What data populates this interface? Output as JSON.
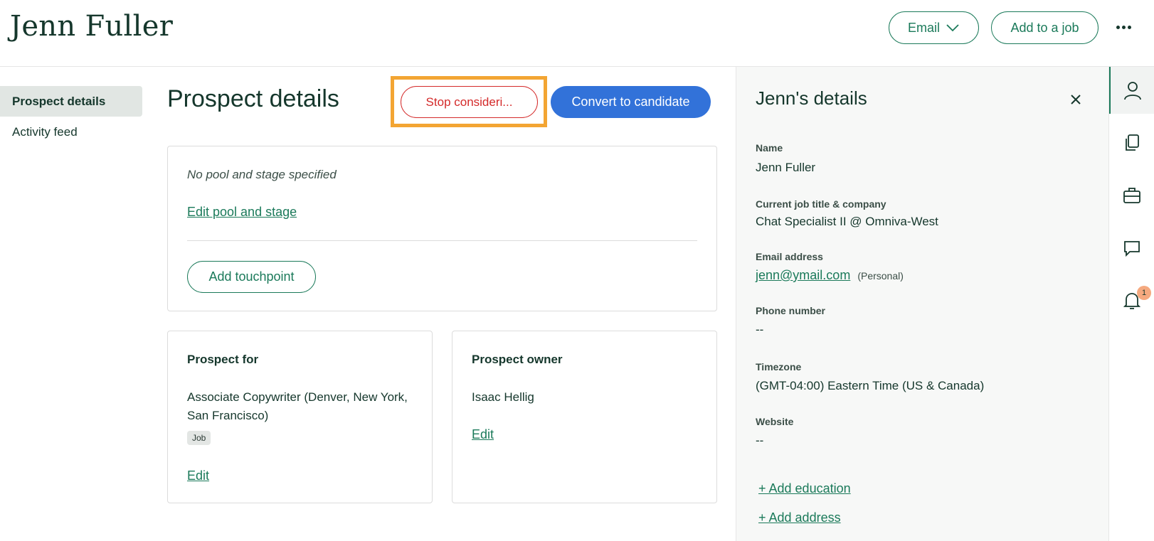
{
  "header": {
    "person_name": "Jenn Fuller",
    "email_label": "Email",
    "add_to_job_label": "Add to a job",
    "more_icon": "more-horizontal-icon"
  },
  "nav": {
    "items": [
      {
        "label": "Prospect details",
        "active": true
      },
      {
        "label": "Activity feed",
        "active": false
      }
    ]
  },
  "main": {
    "title": "Prospect details",
    "stop_label": "Stop consideri...",
    "convert_label": "Convert to candidate",
    "pool": {
      "text": "No pool and stage specified",
      "edit_label": "Edit pool and stage",
      "touchpoint_label": "Add touchpoint"
    },
    "prospect_for": {
      "heading": "Prospect for",
      "value": "Associate Copywriter (Denver, New York, San Francisco)",
      "badge": "Job",
      "edit_label": "Edit"
    },
    "prospect_owner": {
      "heading": "Prospect owner",
      "value": "Isaac Hellig",
      "edit_label": "Edit"
    }
  },
  "panel": {
    "title": "Jenn's details",
    "fields": {
      "name_label": "Name",
      "name_value": "Jenn Fuller",
      "job_label": "Current job title & company",
      "job_value": "Chat Specialist II @ Omniva-West",
      "email_label": "Email address",
      "email_value": "jenn@ymail.com",
      "email_type": "(Personal)",
      "phone_label": "Phone number",
      "phone_value": "--",
      "tz_label": "Timezone",
      "tz_value": "(GMT-04:00) Eastern Time (US & Canada)",
      "website_label": "Website",
      "website_value": "--"
    },
    "add_education": "+ Add education",
    "add_address": "+ Add address"
  },
  "rail": {
    "icons": [
      "person-icon",
      "documents-icon",
      "briefcase-icon",
      "chat-icon",
      "bell-icon"
    ],
    "notification_count": "1"
  },
  "colors": {
    "primary_green": "#1b7a5a",
    "danger_red": "#d42a2a",
    "blue": "#3272d9",
    "highlight": "#f3a533",
    "badge_orange": "#f5a97f"
  }
}
